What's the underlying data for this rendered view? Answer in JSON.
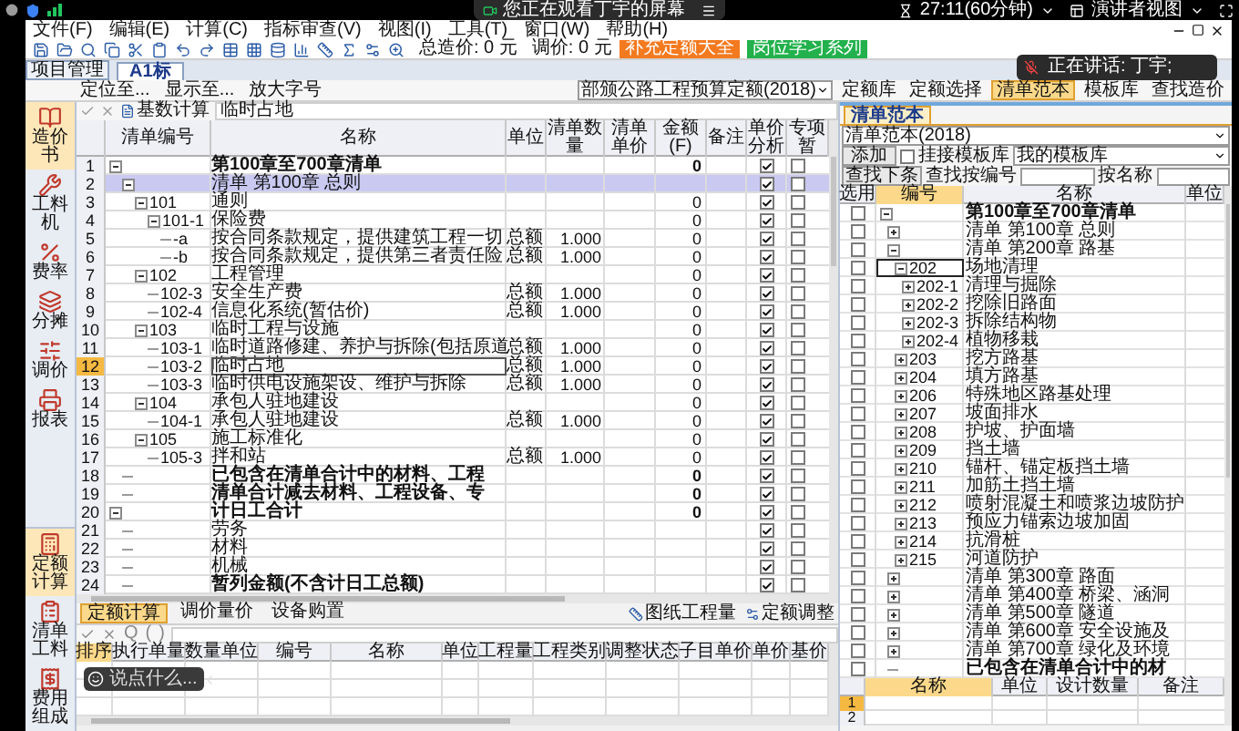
{
  "meeting_bar": {
    "viewing": "您正在观看丁宇的屏幕",
    "timer": "27:11(60分钟)",
    "view_mode": "演讲者视图"
  },
  "menu": [
    "文件(F)",
    "编辑(E)",
    "计算(C)",
    "指标审查(V)",
    "视图(I)",
    "工具(T)",
    "窗口(W)",
    "帮助(H)"
  ],
  "toolbar": {
    "total_cost": "总造价: 0 元",
    "adjust": "调价: 0 元",
    "buttons": [
      {
        "label": "补充定额大全",
        "color": "#f47a20"
      },
      {
        "label": "岗位学习系列",
        "color": "#22b14c"
      }
    ]
  },
  "project_button": "项目管理",
  "doc_tabs": [
    {
      "label": "A1标",
      "selected": true
    }
  ],
  "locate_bar": {
    "items": [
      "定位至...",
      "显示至...",
      "放大字号"
    ],
    "quota_set": "部颁公路工程预算定额(2018)",
    "panel_buttons": [
      {
        "label": "定额库",
        "selected": false
      },
      {
        "label": "定额选择",
        "selected": false
      },
      {
        "label": "清单范本",
        "selected": true
      },
      {
        "label": "模板库",
        "selected": false
      },
      {
        "label": "查找造价",
        "selected": false
      }
    ]
  },
  "sidebar_top": [
    {
      "label": "造价书",
      "selected": true
    },
    {
      "label": "工料机",
      "selected": false
    },
    {
      "label": "费率",
      "selected": false
    },
    {
      "label": "分摊",
      "selected": false
    },
    {
      "label": "调价",
      "selected": false
    },
    {
      "label": "报表",
      "selected": false
    }
  ],
  "sidebar_bottom": [
    {
      "label": "定额计算",
      "selected": true
    },
    {
      "label": "清单工料",
      "selected": false
    },
    {
      "label": "费用组成",
      "selected": false
    }
  ],
  "formula_row": {
    "button": "基数计算",
    "value": "临时占地"
  },
  "main_grid": {
    "columns": [
      "清单编号",
      "名称",
      "单位",
      "清单数量",
      "清单单价",
      "金额(F)",
      "备注",
      "单价分析",
      "专项暂"
    ],
    "rows": [
      {
        "no": "1",
        "name": "第100章至700章清单",
        "amount": "0",
        "bold": true,
        "expanded": true,
        "selected": false,
        "focused": false,
        "analysis": true,
        "special": false,
        "children": [
          {
            "no": "2",
            "name": "清单 第100章 总则",
            "bold": false,
            "expanded": true,
            "selected": true,
            "focused": false,
            "analysis": true,
            "special": false,
            "children": [
              {
                "no": "3",
                "code": "101",
                "name": "通则",
                "amount": "0",
                "bold": false,
                "expanded": true,
                "selected": false,
                "focused": false,
                "analysis": true,
                "special": false,
                "children": [
                  {
                    "no": "4",
                    "code": "101-1",
                    "name": "保险费",
                    "amount": "0",
                    "bold": false,
                    "expanded": true,
                    "selected": false,
                    "focused": false,
                    "analysis": true,
                    "special": false,
                    "children": [
                      {
                        "no": "5",
                        "code": "-a",
                        "name": "按合同条款规定，提供建筑工程一切",
                        "unit": "总额",
                        "qty": "1.000",
                        "amount": "0",
                        "bold": false,
                        "selected": false,
                        "focused": false,
                        "analysis": true,
                        "special": false
                      },
                      {
                        "no": "6",
                        "code": "-b",
                        "name": "按合同条款规定，提供第三者责任险",
                        "unit": "总额",
                        "qty": "1.000",
                        "amount": "0",
                        "bold": false,
                        "selected": false,
                        "focused": false,
                        "analysis": true,
                        "special": false
                      }
                    ]
                  }
                ]
              },
              {
                "no": "7",
                "code": "102",
                "name": "工程管理",
                "amount": "0",
                "bold": false,
                "expanded": true,
                "selected": false,
                "focused": false,
                "analysis": true,
                "special": false,
                "children": [
                  {
                    "no": "8",
                    "code": "102-3",
                    "name": "安全生产费",
                    "unit": "总额",
                    "qty": "1.000",
                    "amount": "0",
                    "bold": false,
                    "selected": false,
                    "focused": false,
                    "analysis": true,
                    "special": false
                  },
                  {
                    "no": "9",
                    "code": "102-4",
                    "name": "信息化系统(暂估价)",
                    "unit": "总额",
                    "qty": "1.000",
                    "amount": "0",
                    "bold": false,
                    "selected": false,
                    "focused": false,
                    "analysis": true,
                    "special": false
                  }
                ]
              },
              {
                "no": "10",
                "code": "103",
                "name": "临时工程与设施",
                "amount": "0",
                "bold": false,
                "expanded": true,
                "selected": false,
                "focused": false,
                "analysis": true,
                "special": false,
                "children": [
                  {
                    "no": "11",
                    "code": "103-1",
                    "name": "临时道路修建、养护与拆除(包括原道",
                    "unit": "总额",
                    "qty": "1.000",
                    "amount": "0",
                    "bold": false,
                    "selected": false,
                    "focused": false,
                    "analysis": true,
                    "special": false
                  },
                  {
                    "no": "12",
                    "code": "103-2",
                    "name": "临时占地",
                    "unit": "总额",
                    "qty": "1.000",
                    "amount": "0",
                    "bold": false,
                    "selected": false,
                    "focused": true,
                    "analysis": true,
                    "special": false
                  },
                  {
                    "no": "13",
                    "code": "103-3",
                    "name": "临时供电设施架设、维护与拆除",
                    "unit": "总额",
                    "qty": "1.000",
                    "amount": "0",
                    "bold": false,
                    "selected": false,
                    "focused": false,
                    "analysis": true,
                    "special": false
                  }
                ]
              },
              {
                "no": "14",
                "code": "104",
                "name": "承包人驻地建设",
                "amount": "0",
                "bold": false,
                "expanded": true,
                "selected": false,
                "focused": false,
                "analysis": true,
                "special": false,
                "children": [
                  {
                    "no": "15",
                    "code": "104-1",
                    "name": "承包人驻地建设",
                    "unit": "总额",
                    "qty": "1.000",
                    "amount": "0",
                    "bold": false,
                    "selected": false,
                    "focused": false,
                    "analysis": true,
                    "special": false
                  }
                ]
              },
              {
                "no": "16",
                "code": "105",
                "name": "施工标准化",
                "amount": "0",
                "bold": false,
                "expanded": true,
                "selected": false,
                "focused": false,
                "analysis": true,
                "special": false,
                "children": [
                  {
                    "no": "17",
                    "code": "105-3",
                    "name": "拌和站",
                    "unit": "总额",
                    "qty": "1.000",
                    "amount": "0",
                    "bold": false,
                    "selected": false,
                    "focused": false,
                    "analysis": true,
                    "special": false
                  }
                ]
              }
            ]
          },
          {
            "no": "18",
            "name": "已包含在清单合计中的材料、工程",
            "amount": "0",
            "bold": true,
            "selected": false,
            "focused": false,
            "analysis": true,
            "special": false
          },
          {
            "no": "19",
            "name": "清单合计减去材料、工程设备、专",
            "amount": "0",
            "bold": true,
            "selected": false,
            "focused": false,
            "analysis": true,
            "special": false
          }
        ]
      },
      {
        "no": "20",
        "name": "计日工合计",
        "amount": "0",
        "bold": true,
        "expanded": true,
        "selected": false,
        "focused": false,
        "analysis": true,
        "special": false,
        "children": [
          {
            "no": "21",
            "name": "劳务",
            "bold": false,
            "selected": false,
            "focused": false,
            "analysis": true,
            "special": false
          },
          {
            "no": "22",
            "name": "材料",
            "bold": false,
            "selected": false,
            "focused": false,
            "analysis": true,
            "special": false
          },
          {
            "no": "23",
            "name": "机械",
            "bold": false,
            "selected": false,
            "focused": false,
            "analysis": true,
            "special": false
          },
          {
            "no": "24",
            "name": "暂列金额(不含计日工总额)",
            "bold": true,
            "selected": false,
            "focused": false,
            "analysis": true,
            "special": false
          }
        ]
      }
    ]
  },
  "lower_tabs": [
    {
      "label": "定额计算",
      "selected": true
    },
    {
      "label": "调价量价",
      "selected": false
    },
    {
      "label": "设备购置",
      "selected": false
    }
  ],
  "lower_actions": [
    "图纸工程量",
    "定额调整"
  ],
  "formula_symbols": [
    "Q",
    "(",
    ")"
  ],
  "lower_grid": {
    "columns": [
      "排序",
      "执行单量",
      "数量单位",
      "编号",
      "名称",
      "单位",
      "工程量",
      "工程类别",
      "调整状态",
      "子目单价",
      "单价",
      "基价"
    ]
  },
  "template_panel": {
    "tab": "清单范本",
    "library": "清单范本(2018)",
    "add_button": "添加",
    "link_template": {
      "label": "挂接模板库",
      "checked": false
    },
    "template_library": "我的模板库",
    "find_next": "查找下条",
    "find_by_code": "查找按编号",
    "find_by_name": "按名称",
    "columns": [
      "选用",
      "编号",
      "名称",
      "单位"
    ],
    "rows": [
      {
        "name": "第100章至700章清单",
        "bold": true,
        "expanded": true,
        "checked": false,
        "selected": false,
        "children": [
          {
            "name": "清单 第100章 总则",
            "bold": false,
            "expanded": false,
            "checked": false,
            "selected": false
          },
          {
            "name": "清单 第200章 路基",
            "bold": false,
            "expanded": true,
            "checked": false,
            "selected": false,
            "children": [
              {
                "code": "202",
                "name": "场地清理",
                "bold": false,
                "expanded": true,
                "checked": false,
                "selected": true,
                "children": [
                  {
                    "code": "202-1",
                    "name": "清理与掘除",
                    "bold": false,
                    "expanded": false,
                    "checked": false,
                    "selected": false
                  },
                  {
                    "code": "202-2",
                    "name": "挖除旧路面",
                    "bold": false,
                    "expanded": false,
                    "checked": false,
                    "selected": false
                  },
                  {
                    "code": "202-3",
                    "name": "拆除结构物",
                    "bold": false,
                    "expanded": false,
                    "checked": false,
                    "selected": false
                  },
                  {
                    "code": "202-4",
                    "name": "植物移栽",
                    "bold": false,
                    "expanded": false,
                    "checked": false,
                    "selected": false
                  }
                ]
              },
              {
                "code": "203",
                "name": "挖方路基",
                "bold": false,
                "expanded": false,
                "checked": false,
                "selected": false
              },
              {
                "code": "204",
                "name": "填方路基",
                "bold": false,
                "expanded": false,
                "checked": false,
                "selected": false
              },
              {
                "code": "206",
                "name": "特殊地区路基处理",
                "bold": false,
                "expanded": false,
                "checked": false,
                "selected": false
              },
              {
                "code": "207",
                "name": "坡面排水",
                "bold": false,
                "expanded": false,
                "checked": false,
                "selected": false
              },
              {
                "code": "208",
                "name": "护坡、护面墙",
                "bold": false,
                "expanded": false,
                "checked": false,
                "selected": false
              },
              {
                "code": "209",
                "name": "挡土墙",
                "bold": false,
                "expanded": false,
                "checked": false,
                "selected": false
              },
              {
                "code": "210",
                "name": "锚杆、锚定板挡土墙",
                "bold": false,
                "expanded": false,
                "checked": false,
                "selected": false
              },
              {
                "code": "211",
                "name": "加筋土挡土墙",
                "bold": false,
                "expanded": false,
                "checked": false,
                "selected": false
              },
              {
                "code": "212",
                "name": "喷射混凝土和喷浆边坡防护",
                "bold": false,
                "expanded": false,
                "checked": false,
                "selected": false
              },
              {
                "code": "213",
                "name": "预应力锚索边坡加固",
                "bold": false,
                "expanded": false,
                "checked": false,
                "selected": false
              },
              {
                "code": "214",
                "name": "抗滑桩",
                "bold": false,
                "expanded": false,
                "checked": false,
                "selected": false
              },
              {
                "code": "215",
                "name": "河道防护",
                "bold": false,
                "expanded": false,
                "checked": false,
                "selected": false
              }
            ]
          },
          {
            "name": "清单 第300章 路面",
            "bold": false,
            "expanded": false,
            "checked": false,
            "selected": false
          },
          {
            "name": "清单 第400章 桥梁、涵洞",
            "bold": false,
            "expanded": false,
            "checked": false,
            "selected": false
          },
          {
            "name": "清单 第500章 隧道",
            "bold": false,
            "expanded": false,
            "checked": false,
            "selected": false
          },
          {
            "name": "清单 第600章 安全设施及",
            "bold": false,
            "expanded": false,
            "checked": false,
            "selected": false
          },
          {
            "name": "清单 第700章 绿化及环境",
            "bold": false,
            "expanded": false,
            "checked": false,
            "selected": false
          },
          {
            "name": "已包含在清单合计中的材",
            "bold": true,
            "checked": false,
            "selected": false
          }
        ]
      }
    ],
    "detail_columns": [
      "名称",
      "单位",
      "设计数量",
      "备注"
    ],
    "detail_rows": [
      "1",
      "2"
    ]
  },
  "overlays": {
    "speaking": "正在讲话: 丁宇;",
    "chat_placeholder": "说点什么..."
  }
}
